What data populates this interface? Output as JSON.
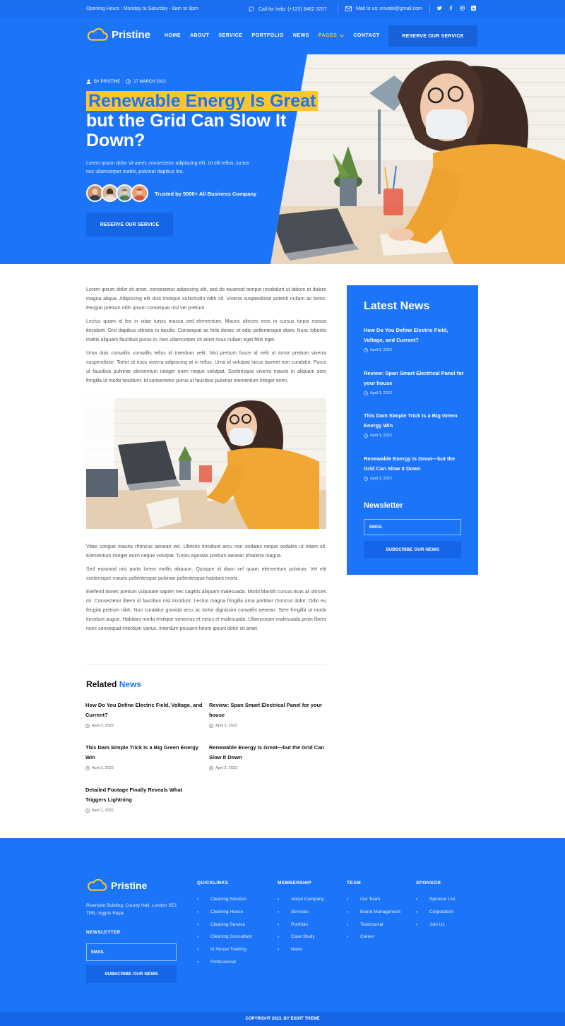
{
  "topbar": {
    "hours": "Opening Hours : Monday to Saturday - 8am to 9pm",
    "call": "Call for help: (+123) 5462 3257",
    "mail": "Mail to us: envato@gmail.com",
    "socials": [
      "twitter-icon",
      "facebook-icon",
      "instagram-icon",
      "linkedin-icon"
    ]
  },
  "brand": {
    "name": "Pristine",
    "accent": "#ffc629",
    "blue": "#1c74f8"
  },
  "nav": {
    "links": [
      "HOME",
      "ABOUT",
      "SERVICE",
      "PORTFOLIO",
      "NEWS",
      "PAGES",
      "CONTACT"
    ],
    "active": "PAGES",
    "cta": "RESERVE OUR SERVICE"
  },
  "hero": {
    "author": "BY PRISTINE",
    "date": "17 MARCH 2023",
    "title_highlight": "Renewable Energy Is Great",
    "title_rest": "but the Grid Can Slow It Down?",
    "description": "Lorem ipsum dolor sit amet, consectetur adipiscing elit. Ut elit tellus, luctus nec ullamcorper mattis, pulvinar dapibus leo.",
    "trusted": "Trusted by 5000+ All Business Company",
    "cta": "RESERVE OUR SERVICE"
  },
  "article": {
    "p1": "Lorem ipsum dolor sit amet, consectetur adipiscing elit, sed do eiusmod tempor incididunt ut labore et dolore magna aliqua. Adipiscing elit duis tristique sollicitudin nibh sit. Viverra suspendisse potenti nullam ac tortor. Feugiat pretium nibh ipsum consequat nisl vel pretium.",
    "p2": "Lectus quam id leo in vitae turpis massa sed elementum. Mauris ultrices eros in cursus turpis massa tincidunt. Orci dapibus ultrices in iaculis. Consequat ac felis donec et odio pellentesque diam. Nunc lobortis mattis aliquam faucibus purus in. Nec ullamcorper sit amet risus nullam eget felis eget.",
    "p3": "Urna duis convallis convallis tellus id interdum velit. Nisl pretium fusce id velit ut tortor pretium viverra suspendisse. Tortor at risus viverra adipiscing at in tellus. Urna id volutpat lacus laoreet non curabitur. Purus ut faucibus pulvinar elementum integer enim neque volutpat. Scelerisque viverra mauris in aliquam sem fringilla ut morbi tincidunt. Id consectetur purus ut faucibus pulvinar elementum integer enim.",
    "p4": "Vitae congue mauris rhoncus aenean vel. Ultrices tincidunt arcu non sodales neque sodales ut etiam sit. Elementum integer enim neque volutpat. Turpis egestas pretium aenean pharetra magna.",
    "p5": "Sed euismod nisi porta lorem mollis aliquam. Quisque id diam vel quam elementum pulvinar. Vel elit scelerisque mauris pellentesque pulvinar pellentesque habitant morbi.",
    "p6": "Eleifend donec pretium vulputate sapien nec sagittis aliquam malesuada. Morbi blandit cursus risus at ultrices mi. Consectetur libero id faucibus nisl tincidunt. Lectus magna fringilla urna porttitor rhoncus dolor. Odio eu feugiat pretium nibh. Non curabitur gravida arcu ac tortor dignissim convallis aenean. Sem fringilla ut morbi tincidunt augue. Habitant morbi tristique senectus et netus et malesuada. Ullamcorper malesuada proin libero nunc consequat interdum varius. Interdum posuere lorem ipsum dolor sit amet."
  },
  "related": {
    "title_a": "Related",
    "title_b": "News",
    "items": [
      {
        "title": "How Do You Define Electric Field, Voltage, and Current?",
        "date": "April 3, 2022"
      },
      {
        "title": "Review: Span Smart Electrical Panel for your house",
        "date": "April 3, 2022"
      },
      {
        "title": "This Dam Simple Trick Is a Big Green Energy Win",
        "date": "April 3, 2022"
      },
      {
        "title": "Renewable Energy Is Great—but the Grid Can Slow It Down",
        "date": "April 3, 2022"
      },
      {
        "title": "Detailed Footage Finally Reveals What Triggers Lightning",
        "date": "April 1, 2022"
      }
    ]
  },
  "sidebar": {
    "title": "Latest News",
    "items": [
      {
        "title": "How Do You Define Electric Field, Voltage, and Current?",
        "date": "April 3, 2022"
      },
      {
        "title": "Review: Span Smart Electrical Panel for your house",
        "date": "April 3, 2022"
      },
      {
        "title": "This Dam Simple Trick Is a Big Green Energy Win",
        "date": "April 3, 2022"
      },
      {
        "title": "Renewable Energy Is Great—but the Grid Can Slow It Down",
        "date": "April 3, 2022"
      }
    ],
    "newsletter_title": "Newsletter",
    "email_placeholder": "EMAIL",
    "subscribe": "SUBSCRIBE OUR NEWS"
  },
  "footer": {
    "brand": "Pristine",
    "address": "Riverside Building, County Hall, London SE1 7PB, Inggris Raya",
    "newsletter_title": "NEWSLETTER",
    "email_placeholder": "EMAIL",
    "subscribe": "SUBSCRIBE OUR NEWS",
    "columns": [
      {
        "title": "QUICKLINKS",
        "links": [
          "Cleaning Solution",
          "Cleaning House",
          "Cleaning Service",
          "Cleaning Consultant",
          "In House Training",
          "Professional"
        ]
      },
      {
        "title": "MEMBERSHIP",
        "links": [
          "About Company",
          "Services",
          "Portfolio",
          "Case Study",
          "News"
        ]
      },
      {
        "title": "TEAM",
        "links": [
          "Our Team",
          "Board Management",
          "Testimonial",
          "Career"
        ]
      },
      {
        "title": "SPONSOR",
        "links": [
          "Sponsor List",
          "Corporation",
          "Join Us"
        ]
      }
    ],
    "copyright": "COPYRIGHT 2023. BY EIGHT THEME"
  }
}
